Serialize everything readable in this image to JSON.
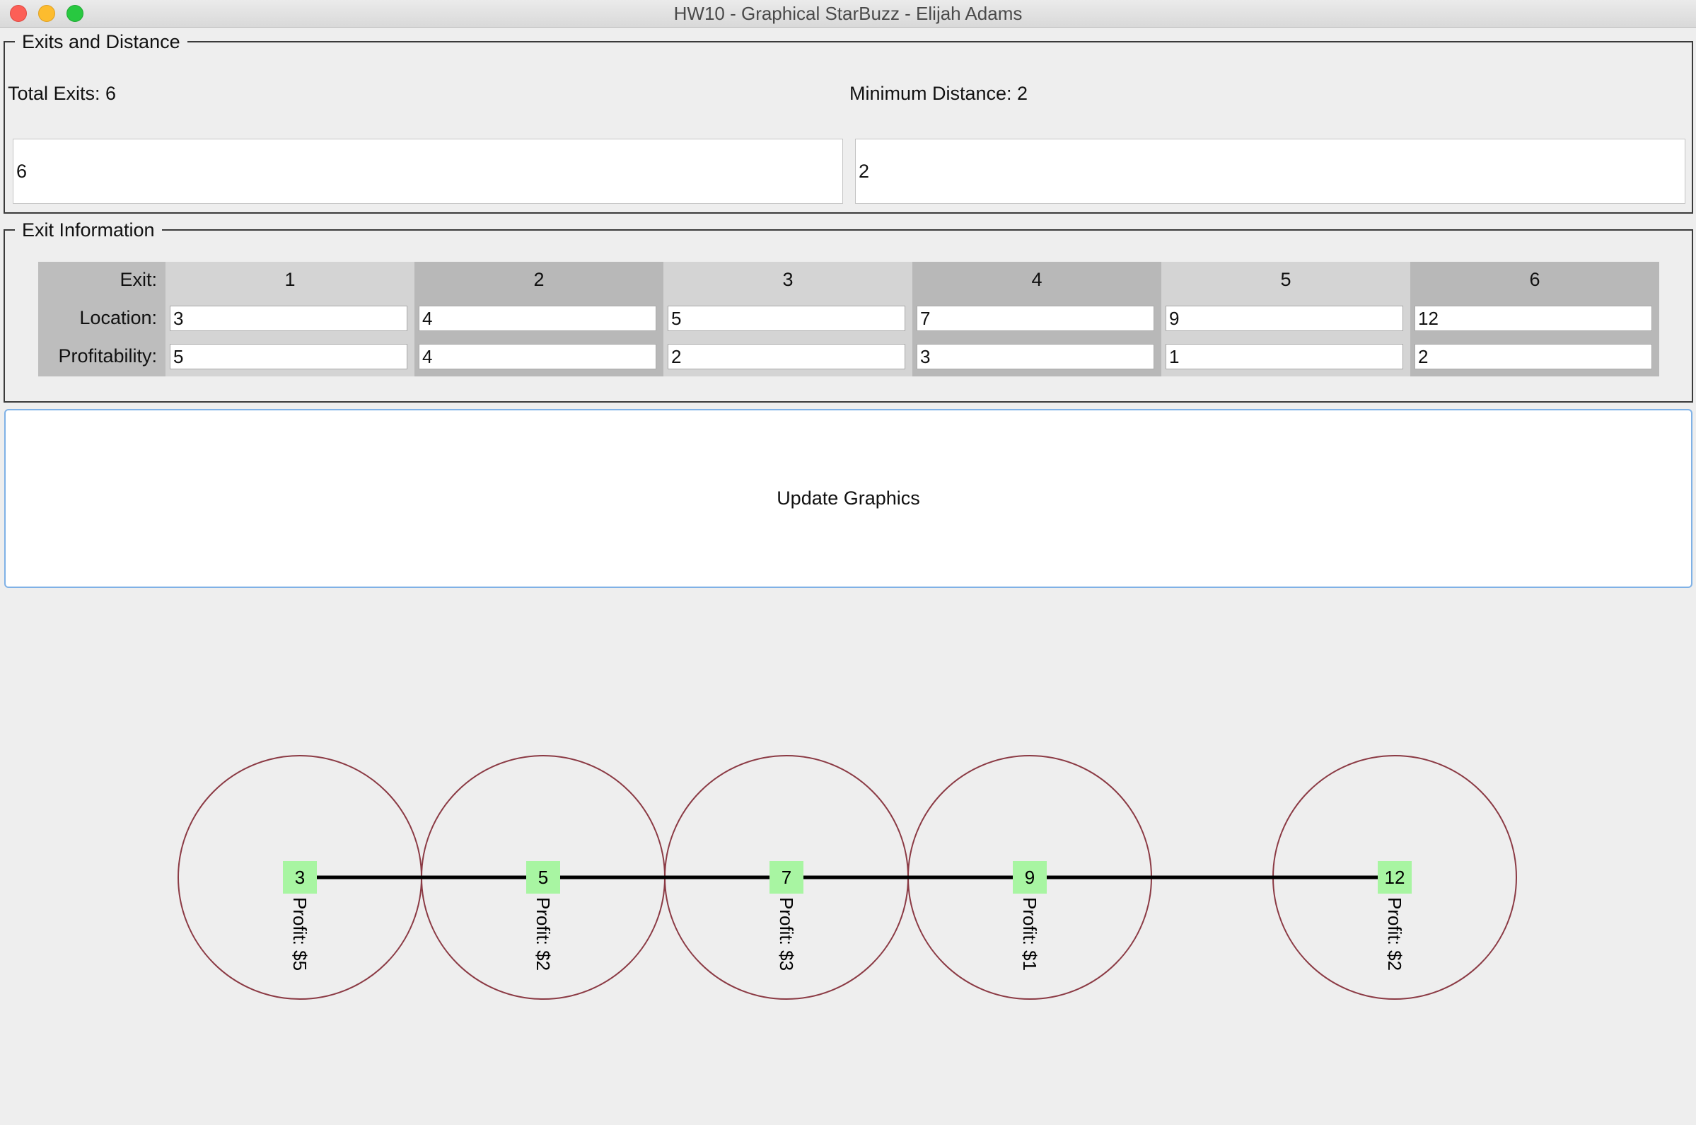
{
  "window": {
    "title": "HW10 - Graphical StarBuzz - Elijah Adams"
  },
  "exits_panel": {
    "title": "Exits and Distance",
    "total_exits_label": "Total Exits: 6",
    "minimum_distance_label": "Minimum Distance: 2",
    "total_exits_value": "6",
    "minimum_distance_value": "2"
  },
  "info_panel": {
    "title": "Exit Information",
    "row_labels": {
      "exit": "Exit:",
      "location": "Location:",
      "profitability": "Profitability:"
    },
    "exits": [
      {
        "exit": "1",
        "location": "3",
        "profitability": "5"
      },
      {
        "exit": "2",
        "location": "4",
        "profitability": "4"
      },
      {
        "exit": "3",
        "location": "5",
        "profitability": "2"
      },
      {
        "exit": "4",
        "location": "7",
        "profitability": "3"
      },
      {
        "exit": "5",
        "location": "9",
        "profitability": "1"
      },
      {
        "exit": "6",
        "location": "12",
        "profitability": "2"
      }
    ]
  },
  "update_button": {
    "label": "Update Graphics"
  },
  "graphic": {
    "nodes": [
      {
        "location": "3",
        "profit_label": "Profit: $5"
      },
      {
        "location": "5",
        "profit_label": "Profit: $2"
      },
      {
        "location": "7",
        "profit_label": "Profit: $3"
      },
      {
        "location": "9",
        "profit_label": "Profit: $1"
      },
      {
        "location": "12",
        "profit_label": "Profit: $2"
      }
    ],
    "colors": {
      "circle_stroke": "#8b3a44",
      "node_fill": "#a8f5a2",
      "line": "#000000"
    }
  }
}
